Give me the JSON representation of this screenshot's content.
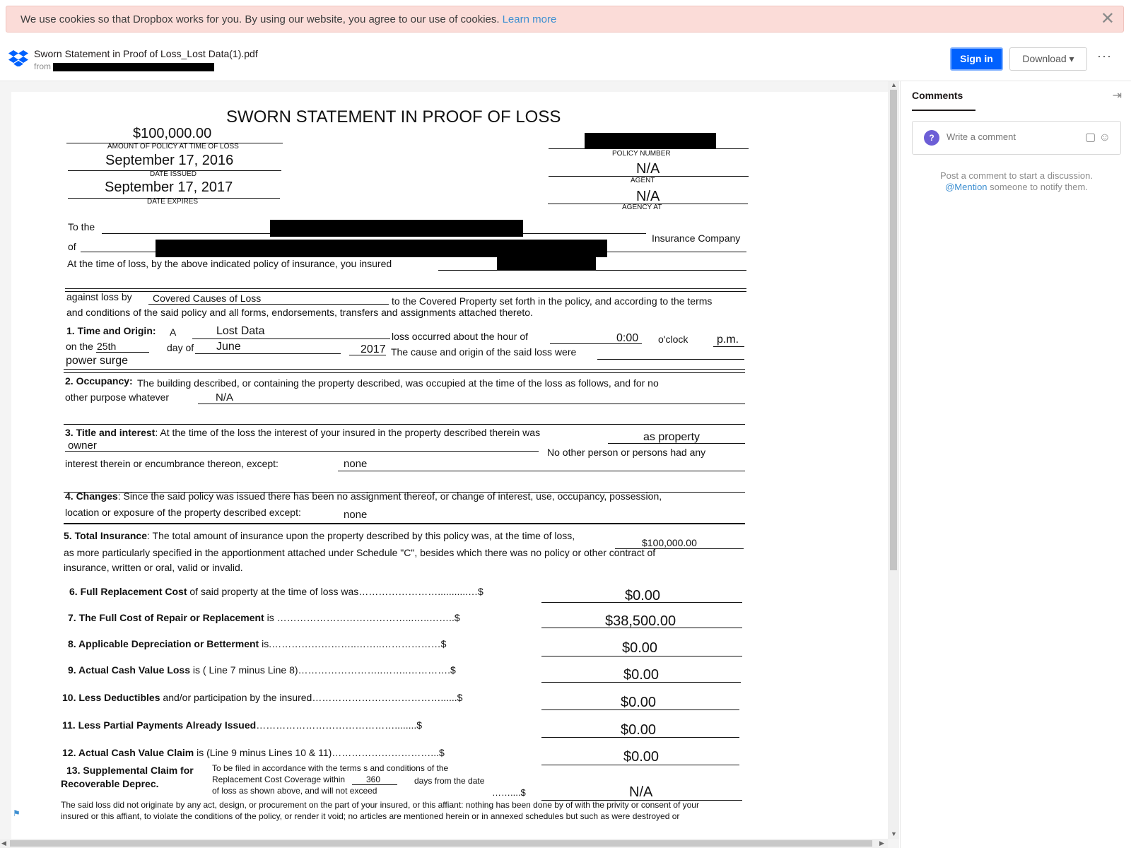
{
  "cookie": {
    "text": "We use cookies so that Dropbox works for you. By using our website, you agree to our use of cookies.",
    "link": "Learn more",
    "close": "✕"
  },
  "header": {
    "file_name": "Sworn Statement in Proof of Loss_Lost Data(1).pdf",
    "from_label": "from",
    "sign_in": "Sign in",
    "download": "Download ▾",
    "more": "···"
  },
  "sidebar": {
    "tab": "Comments",
    "collapse": "⇥",
    "avatar": "?",
    "comment_placeholder": "Write a comment",
    "comment_icons": "▢ ☺",
    "hint_line1": "Post a comment to start a discussion.",
    "hint_mention": "@Mention",
    "hint_line2": "someone to notify them."
  },
  "doc": {
    "title": "SWORN STATEMENT IN PROOF OF LOSS",
    "amount": "$100,000.00",
    "amount_label": "AMOUNT OF POLICY AT TIME OF LOSS",
    "date_issued": "September 17, 2016",
    "date_issued_label": "DATE ISSUED",
    "date_expires": "September 17, 2017",
    "date_expires_label": "DATE EXPIRES",
    "policy_number_label": "POLICY NUMBER",
    "agent": "N/A",
    "agent_label": "AGENT",
    "agency_at": "N/A",
    "agency_at_label": "AGENCY AT",
    "to_the": "To the",
    "insurance_company": "Insurance Company",
    "of": "of",
    "at_time_of_loss": "At  the  time  of  loss,  by  the  above indicated  policy  of  insurance, you  insured",
    "against_loss_by": "against  loss  by",
    "covered_causes": "Covered Causes of Loss",
    "to_covered_property": "to the Covered Property set forth in the policy, and according to the terms",
    "and_conditions": "and conditions of the said policy and all forms, endorsements, transfers and assignments attached thereto.",
    "s1_label": "1. Time and Origin:",
    "s1_a": "A",
    "s1_lost_data": "Lost Data",
    "s1_loss_occurred": "loss occurred about the hour of",
    "s1_hour": "0:00",
    "s1_oclock": "o'clock",
    "s1_pm": "p.m.",
    "s1_on_the": "on the",
    "s1_day": "25th",
    "s1_day_of": "day of",
    "s1_month": "June",
    "s1_year": "2017",
    "s1_cause": "The cause and origin of the said loss were",
    "s1_cause_value": "power surge",
    "s2_label": "2. Occupancy:",
    "s2_text": "The building described, or containing the property described, was occupied at the time of the loss as follows, and for no",
    "s2_other": "other   purpose   whatever",
    "s2_value": "N/A",
    "s3_label": "3. Title and interest",
    "s3_text": ": At the time of the loss the interest of your insured in the property described therein was",
    "s3_value1": "as property",
    "s3_value2": "owner",
    "s3_no_other": "No other person or persons had any",
    "s3_interest": "interest   therein   or   encumbrance   thereon,   except:",
    "s3_except": "none",
    "s4_label": "4. Changes",
    "s4_text": ":  Since the said policy was issued there has been no assignment thereof, or change of interest, use, occupancy, possession,",
    "s4_location": "location or exposure of  the  property described  except:",
    "s4_except": "none",
    "s5_label": "5. Total Insurance",
    "s5_text": ":  The total amount of insurance upon the property described by this policy was, at the time of loss,",
    "s5_value": "$100,000.00",
    "s5_line2": "as more particularly specified in the apportionment attached under Schedule \"C\", besides which there was no policy or other contract of",
    "s5_line3": "insurance, written or oral, valid or invalid.",
    "l6_bold": "6. Full Replacement Cost",
    "l6_rest": " of said property at the time of loss was……………………...........…$",
    "l6_value": "$0.00",
    "l7_bold": "7. The Full Cost of Repair or Replacement",
    "l7_rest": " is …………………………………...…..……..$",
    "l7_value": "$38,500.00",
    "l8_bold": "8. Applicable Depreciation or Betterment",
    "l8_rest": " is.……………………..……..………………$",
    "l8_value": "$0.00",
    "l9_bold": "9. Actual Cash Value Loss",
    "l9_rest": " is ( Line 7 minus Line 8)……………………..……..………….$",
    "l9_value": "$0.00",
    "l10_bold": "10. Less Deductibles",
    "l10_rest": " and/or participation by the insured…………………………………......$",
    "l10_value": "$0.00",
    "l11_bold": "11. Less Partial Payments Already Issued",
    "l11_rest": "……………………………………........$",
    "l11_value": "$0.00",
    "l12_bold": "12. Actual Cash Value Claim",
    "l12_rest": " is (Line 9 minus Lines 10 & 11)…………………………...$",
    "l12_value": "$0.00",
    "l13_bold1": "13. Supplemental Claim for",
    "l13_bold2": "Recoverable Deprec.",
    "l13_text1": "To be filed in accordance with the terms s and conditions of the",
    "l13_text2": "Replacement Cost Coverage within",
    "l13_days": "360",
    "l13_days_from": "days from the date",
    "l13_text3": "of loss as shown above, and will not exceed",
    "l13_dots": "……....$",
    "l13_value": "N/A",
    "footer1": "The said loss did not originate by any act, design, or procurement on the part of your insured, or this affiant: nothing has been done by of with the privity or consent of your",
    "footer2": "insured or this affiant, to violate the conditions of the policy, or render it void; no articles are mentioned herein or in annexed schedules but such as were destroyed or"
  },
  "colors": {
    "accent": "#0061fe",
    "cookie_bg": "#fbdcd8",
    "link": "#3d8fd1"
  }
}
